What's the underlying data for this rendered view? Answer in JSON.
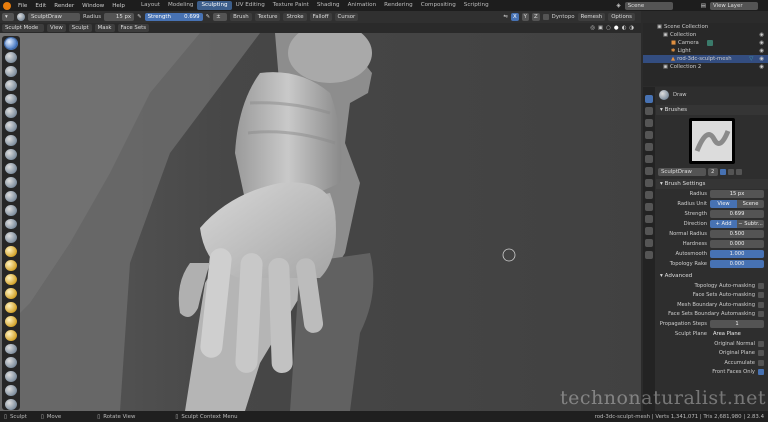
{
  "topbar": {
    "menus": [
      "File",
      "Edit",
      "Render",
      "Window",
      "Help"
    ],
    "workspaces": [
      "Layout",
      "Modeling",
      "Sculpting",
      "UV Editing",
      "Texture Paint",
      "Shading",
      "Animation",
      "Rendering",
      "Compositing",
      "Scripting"
    ],
    "active_workspace": "Sculpting",
    "scene": "Scene",
    "view_layer": "View Layer"
  },
  "tool_header": {
    "brush_name": "SculptDraw",
    "radius_label": "Radius",
    "radius_value": "15 px",
    "strength_label": "Strength",
    "strength_value": "0.699",
    "menus": [
      "Brush",
      "Texture",
      "Stroke",
      "Falloff",
      "Cursor"
    ],
    "axes": [
      "X",
      "Y",
      "Z"
    ],
    "dyntopo": "Dyntopo",
    "remesh": "Remesh",
    "options": "Options"
  },
  "mode_header": {
    "mode": "Sculpt Mode",
    "menus": [
      "View",
      "Sculpt",
      "Mask",
      "Face Sets"
    ]
  },
  "outliner": {
    "search_placeholder": "",
    "items": [
      {
        "label": "Scene Collection",
        "indent": 0
      },
      {
        "label": "Collection",
        "indent": 1
      },
      {
        "label": "Camera",
        "indent": 2
      },
      {
        "label": "Light",
        "indent": 2
      },
      {
        "label": "rod-3dc-sculpt-mesh",
        "indent": 2,
        "selected": true
      },
      {
        "label": "Collection 2",
        "indent": 1
      }
    ]
  },
  "props": {
    "brush_display": "Draw",
    "brushes_section": "Brushes",
    "brush_field": "SculptDraw",
    "brush_users": "2",
    "brush_settings_section": "Brush Settings",
    "radius_label": "Radius",
    "radius_value": "15 px",
    "radius_unit_label": "Radius Unit",
    "radius_unit_view": "View",
    "radius_unit_scene": "Scene",
    "strength_label": "Strength",
    "strength_value": "0.699",
    "direction_label": "Direction",
    "direction_add": "+ Add",
    "direction_subtract": "− Subtr...",
    "normal_radius_label": "Normal Radius",
    "normal_radius_value": "0.500",
    "hardness_label": "Hardness",
    "hardness_value": "0.000",
    "autosmooth_label": "Autosmooth",
    "autosmooth_value": "1.000",
    "topology_rake_label": "Topology Rake",
    "topology_rake_value": "0.000",
    "advanced_section": "Advanced",
    "checks": [
      {
        "label": "Topology Auto-masking",
        "on": false
      },
      {
        "label": "Face Sets Auto-masking",
        "on": false
      },
      {
        "label": "Mesh Boundary Auto-masking",
        "on": false
      },
      {
        "label": "Face Sets Boundary Automasking",
        "on": false
      }
    ],
    "propagation_label": "Propagation Steps",
    "propagation_value": "1",
    "sculpt_plane_label": "Sculpt Plane",
    "sculpt_plane_value": "Area Plane",
    "checks2": [
      {
        "label": "Original Normal",
        "on": false
      },
      {
        "label": "Original Plane",
        "on": false
      },
      {
        "label": "Accumulate",
        "on": false
      },
      {
        "label": "Front Faces Only",
        "on": true
      }
    ]
  },
  "status": {
    "select": "Sculpt",
    "move": "Move",
    "rotate": "Rotate View",
    "context": "Sculpt Context Menu",
    "stats": "rod-3dc-sculpt-mesh | Verts 1,341,071 | Tris 2,681,980 | 2.83.4"
  },
  "watermark": "technonaturalist.net",
  "colors": {
    "accent": "#4772b3",
    "selected_row": "#334d80",
    "logo": "#e87d0d"
  }
}
